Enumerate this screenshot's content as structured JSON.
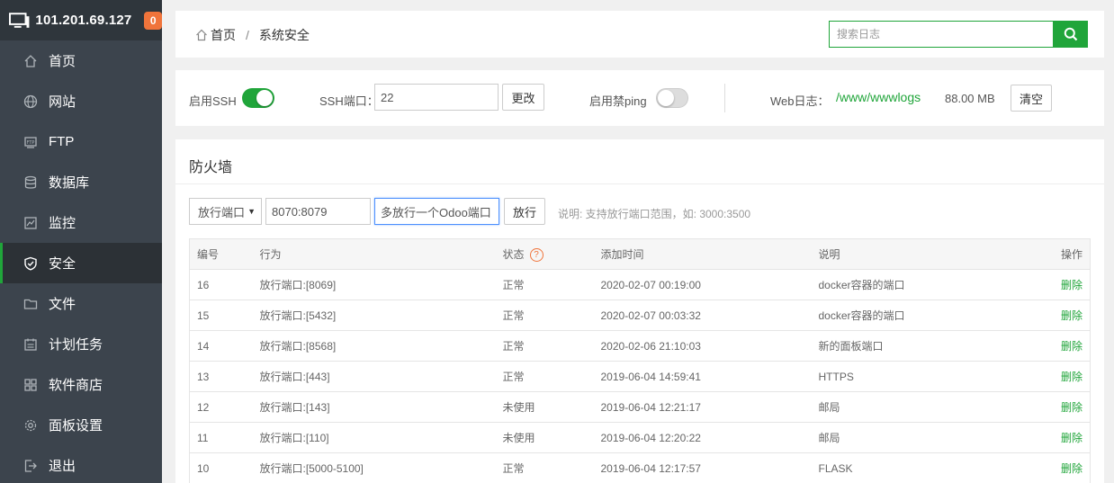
{
  "sidebar": {
    "server_ip": "101.201.69.127",
    "badge_count": "0",
    "items": [
      {
        "label": "首页",
        "icon": "home-icon"
      },
      {
        "label": "网站",
        "icon": "globe-icon"
      },
      {
        "label": "FTP",
        "icon": "ftp-icon"
      },
      {
        "label": "数据库",
        "icon": "database-icon"
      },
      {
        "label": "监控",
        "icon": "monitor-chart-icon"
      },
      {
        "label": "安全",
        "icon": "shield-icon",
        "active": true
      },
      {
        "label": "文件",
        "icon": "folder-icon"
      },
      {
        "label": "计划任务",
        "icon": "calendar-icon"
      },
      {
        "label": "软件商店",
        "icon": "apps-grid-icon"
      },
      {
        "label": "面板设置",
        "icon": "gear-icon"
      },
      {
        "label": "退出",
        "icon": "logout-icon"
      }
    ]
  },
  "header": {
    "breadcrumb_home": "首页",
    "breadcrumb_sep": "/",
    "breadcrumb_current": "系统安全",
    "search_placeholder": "搜索日志"
  },
  "settings": {
    "ssh_label": "启用SSH",
    "ssh_enabled": true,
    "ssh_port_label": "SSH端口：",
    "ssh_port_value": "22",
    "change_button": "更改",
    "ping_label": "启用禁ping",
    "ping_enabled": false,
    "weblog_label": "Web日志：",
    "weblog_path": "/www/wwwlogs",
    "weblog_size": "88.00 MB",
    "clear_button": "清空"
  },
  "firewall": {
    "title": "防火墙",
    "type_selected": "放行端口",
    "port_value": "8070:8079",
    "desc_value": "多放行一个Odoo端口",
    "allow_button": "放行",
    "hint": "说明: 支持放行端口范围，如: 3000:3500",
    "columns": [
      "编号",
      "行为",
      "状态",
      "添加时间",
      "说明",
      "操作"
    ],
    "status_help": "?",
    "rows": [
      {
        "id": "16",
        "action": "放行端口:[8069]",
        "status": "正常",
        "time": "2020-02-07 00:19:00",
        "note": "docker容器的端口",
        "op": "删除"
      },
      {
        "id": "15",
        "action": "放行端口:[5432]",
        "status": "正常",
        "time": "2020-02-07 00:03:32",
        "note": "docker容器的端口",
        "op": "删除"
      },
      {
        "id": "14",
        "action": "放行端口:[8568]",
        "status": "正常",
        "time": "2020-02-06 21:10:03",
        "note": "新的面板端口",
        "op": "删除"
      },
      {
        "id": "13",
        "action": "放行端口:[443]",
        "status": "正常",
        "time": "2019-06-04 14:59:41",
        "note": "HTTPS",
        "op": "删除"
      },
      {
        "id": "12",
        "action": "放行端口:[143]",
        "status": "未使用",
        "time": "2019-06-04 12:21:17",
        "note": "邮局",
        "op": "删除"
      },
      {
        "id": "11",
        "action": "放行端口:[110]",
        "status": "未使用",
        "time": "2019-06-04 12:20:22",
        "note": "邮局",
        "op": "删除"
      },
      {
        "id": "10",
        "action": "放行端口:[5000-5100]",
        "status": "正常",
        "time": "2019-06-04 12:17:57",
        "note": "FLASK",
        "op": "删除"
      }
    ]
  },
  "colors": {
    "accent": "#20a53a",
    "badge": "#f0743b",
    "sidebar_bg": "#3c444d"
  }
}
